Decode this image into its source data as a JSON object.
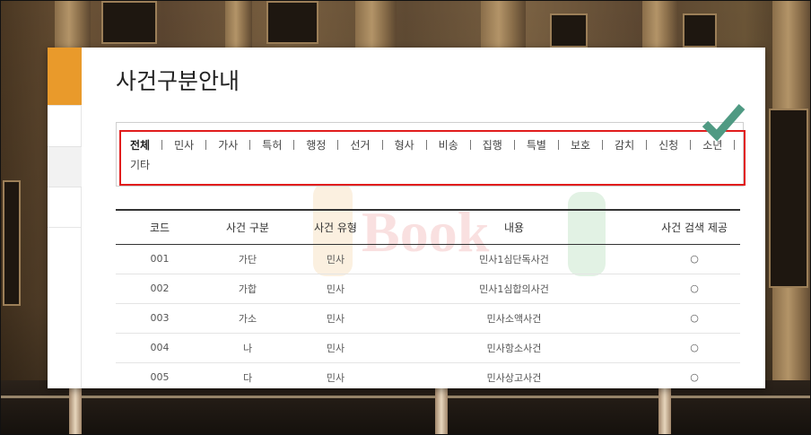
{
  "page": {
    "title": "사건구분안내"
  },
  "filters": [
    {
      "label": "전체",
      "active": true
    },
    {
      "label": "민사",
      "active": false
    },
    {
      "label": "가사",
      "active": false
    },
    {
      "label": "특허",
      "active": false
    },
    {
      "label": "행정",
      "active": false
    },
    {
      "label": "선거",
      "active": false
    },
    {
      "label": "형사",
      "active": false
    },
    {
      "label": "비송",
      "active": false
    },
    {
      "label": "집행",
      "active": false
    },
    {
      "label": "특별",
      "active": false
    },
    {
      "label": "보호",
      "active": false
    },
    {
      "label": "감치",
      "active": false
    },
    {
      "label": "신청",
      "active": false
    },
    {
      "label": "소년",
      "active": false
    },
    {
      "label": "기타",
      "active": false
    }
  ],
  "table": {
    "headers": {
      "code": "코드",
      "category": "사건 구분",
      "type": "사건 유형",
      "description": "내용",
      "search": "사건 검색 제공"
    },
    "rows": [
      {
        "code": "001",
        "category": "가단",
        "type": "민사",
        "description": "민사1심단독사건",
        "search": "○"
      },
      {
        "code": "002",
        "category": "가합",
        "type": "민사",
        "description": "민사1심합의사건",
        "search": "○"
      },
      {
        "code": "003",
        "category": "가소",
        "type": "민사",
        "description": "민사소액사건",
        "search": "○"
      },
      {
        "code": "004",
        "category": "나",
        "type": "민사",
        "description": "민사항소사건",
        "search": "○"
      },
      {
        "code": "005",
        "category": "다",
        "type": "민사",
        "description": "민사상고사건",
        "search": "○"
      }
    ]
  },
  "watermark": {
    "text": "Book"
  },
  "colors": {
    "accent": "#e99a2b",
    "highlight_border": "#e11d1d",
    "check": "#4f9a83"
  },
  "icons": {
    "check": "check-icon"
  }
}
